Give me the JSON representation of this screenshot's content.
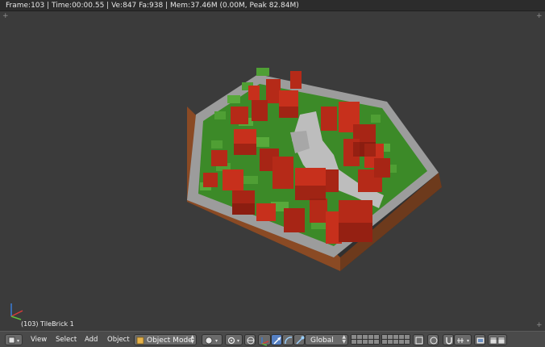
{
  "info_bar": {
    "text": "Frame:103 | Time:00:00.55 | Ve:847 Fa:938 | Mem:37.46M (0.00M, Peak 82.84M)"
  },
  "viewport": {
    "object_label": "(103) TileBrick 1"
  },
  "header": {
    "menus": [
      "View",
      "Select",
      "Add",
      "Object"
    ],
    "mode": "Object Mode",
    "orientation": "Global"
  },
  "colors": {
    "viewport_bg": "#3b3b3b",
    "grass": "#3f8f2a",
    "brick": "#b82a1a",
    "stone": "#b8b8b8",
    "soil": "#7a3a1a",
    "active_button": "#5680c2"
  }
}
